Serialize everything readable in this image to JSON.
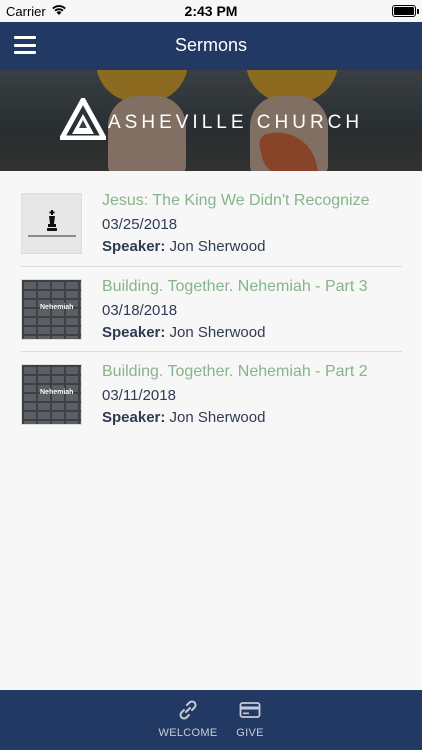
{
  "status_bar": {
    "carrier": "Carrier",
    "time": "2:43 PM",
    "wifi_icon": "wifi-icon",
    "battery_icon": "battery-icon"
  },
  "nav_bar": {
    "title": "Sermons",
    "menu_icon": "hamburger-menu-icon"
  },
  "banner": {
    "logo_text": "ASHEVILLE CHURCH",
    "logo_icon": "asheville-church-logo-icon"
  },
  "sermons": [
    {
      "title": "Jesus: The King We Didn't Recognize",
      "date": "03/25/2018",
      "speaker_label": "Speaker:",
      "speaker": "Jon Sherwood",
      "thumb_style": "chess-king",
      "thumb_label": ""
    },
    {
      "title": "Building. Together. Nehemiah - Part 3",
      "date": "03/18/2018",
      "speaker_label": "Speaker:",
      "speaker": "Jon Sherwood",
      "thumb_style": "brick-wall",
      "thumb_label": "Nehemiah"
    },
    {
      "title": "Building. Together. Nehemiah - Part 2",
      "date": "03/11/2018",
      "speaker_label": "Speaker:",
      "speaker": "Jon Sherwood",
      "thumb_style": "brick-wall",
      "thumb_label": "Nehemiah"
    }
  ],
  "tab_bar": {
    "tabs": [
      {
        "label": "WELCOME",
        "icon": "link-icon"
      },
      {
        "label": "GIVE",
        "icon": "credit-card-icon"
      }
    ]
  },
  "colors": {
    "nav_background": "#223a63",
    "title_accent": "#86b48b",
    "body_text": "#2f3b52",
    "tab_text": "#c6ccd6"
  }
}
